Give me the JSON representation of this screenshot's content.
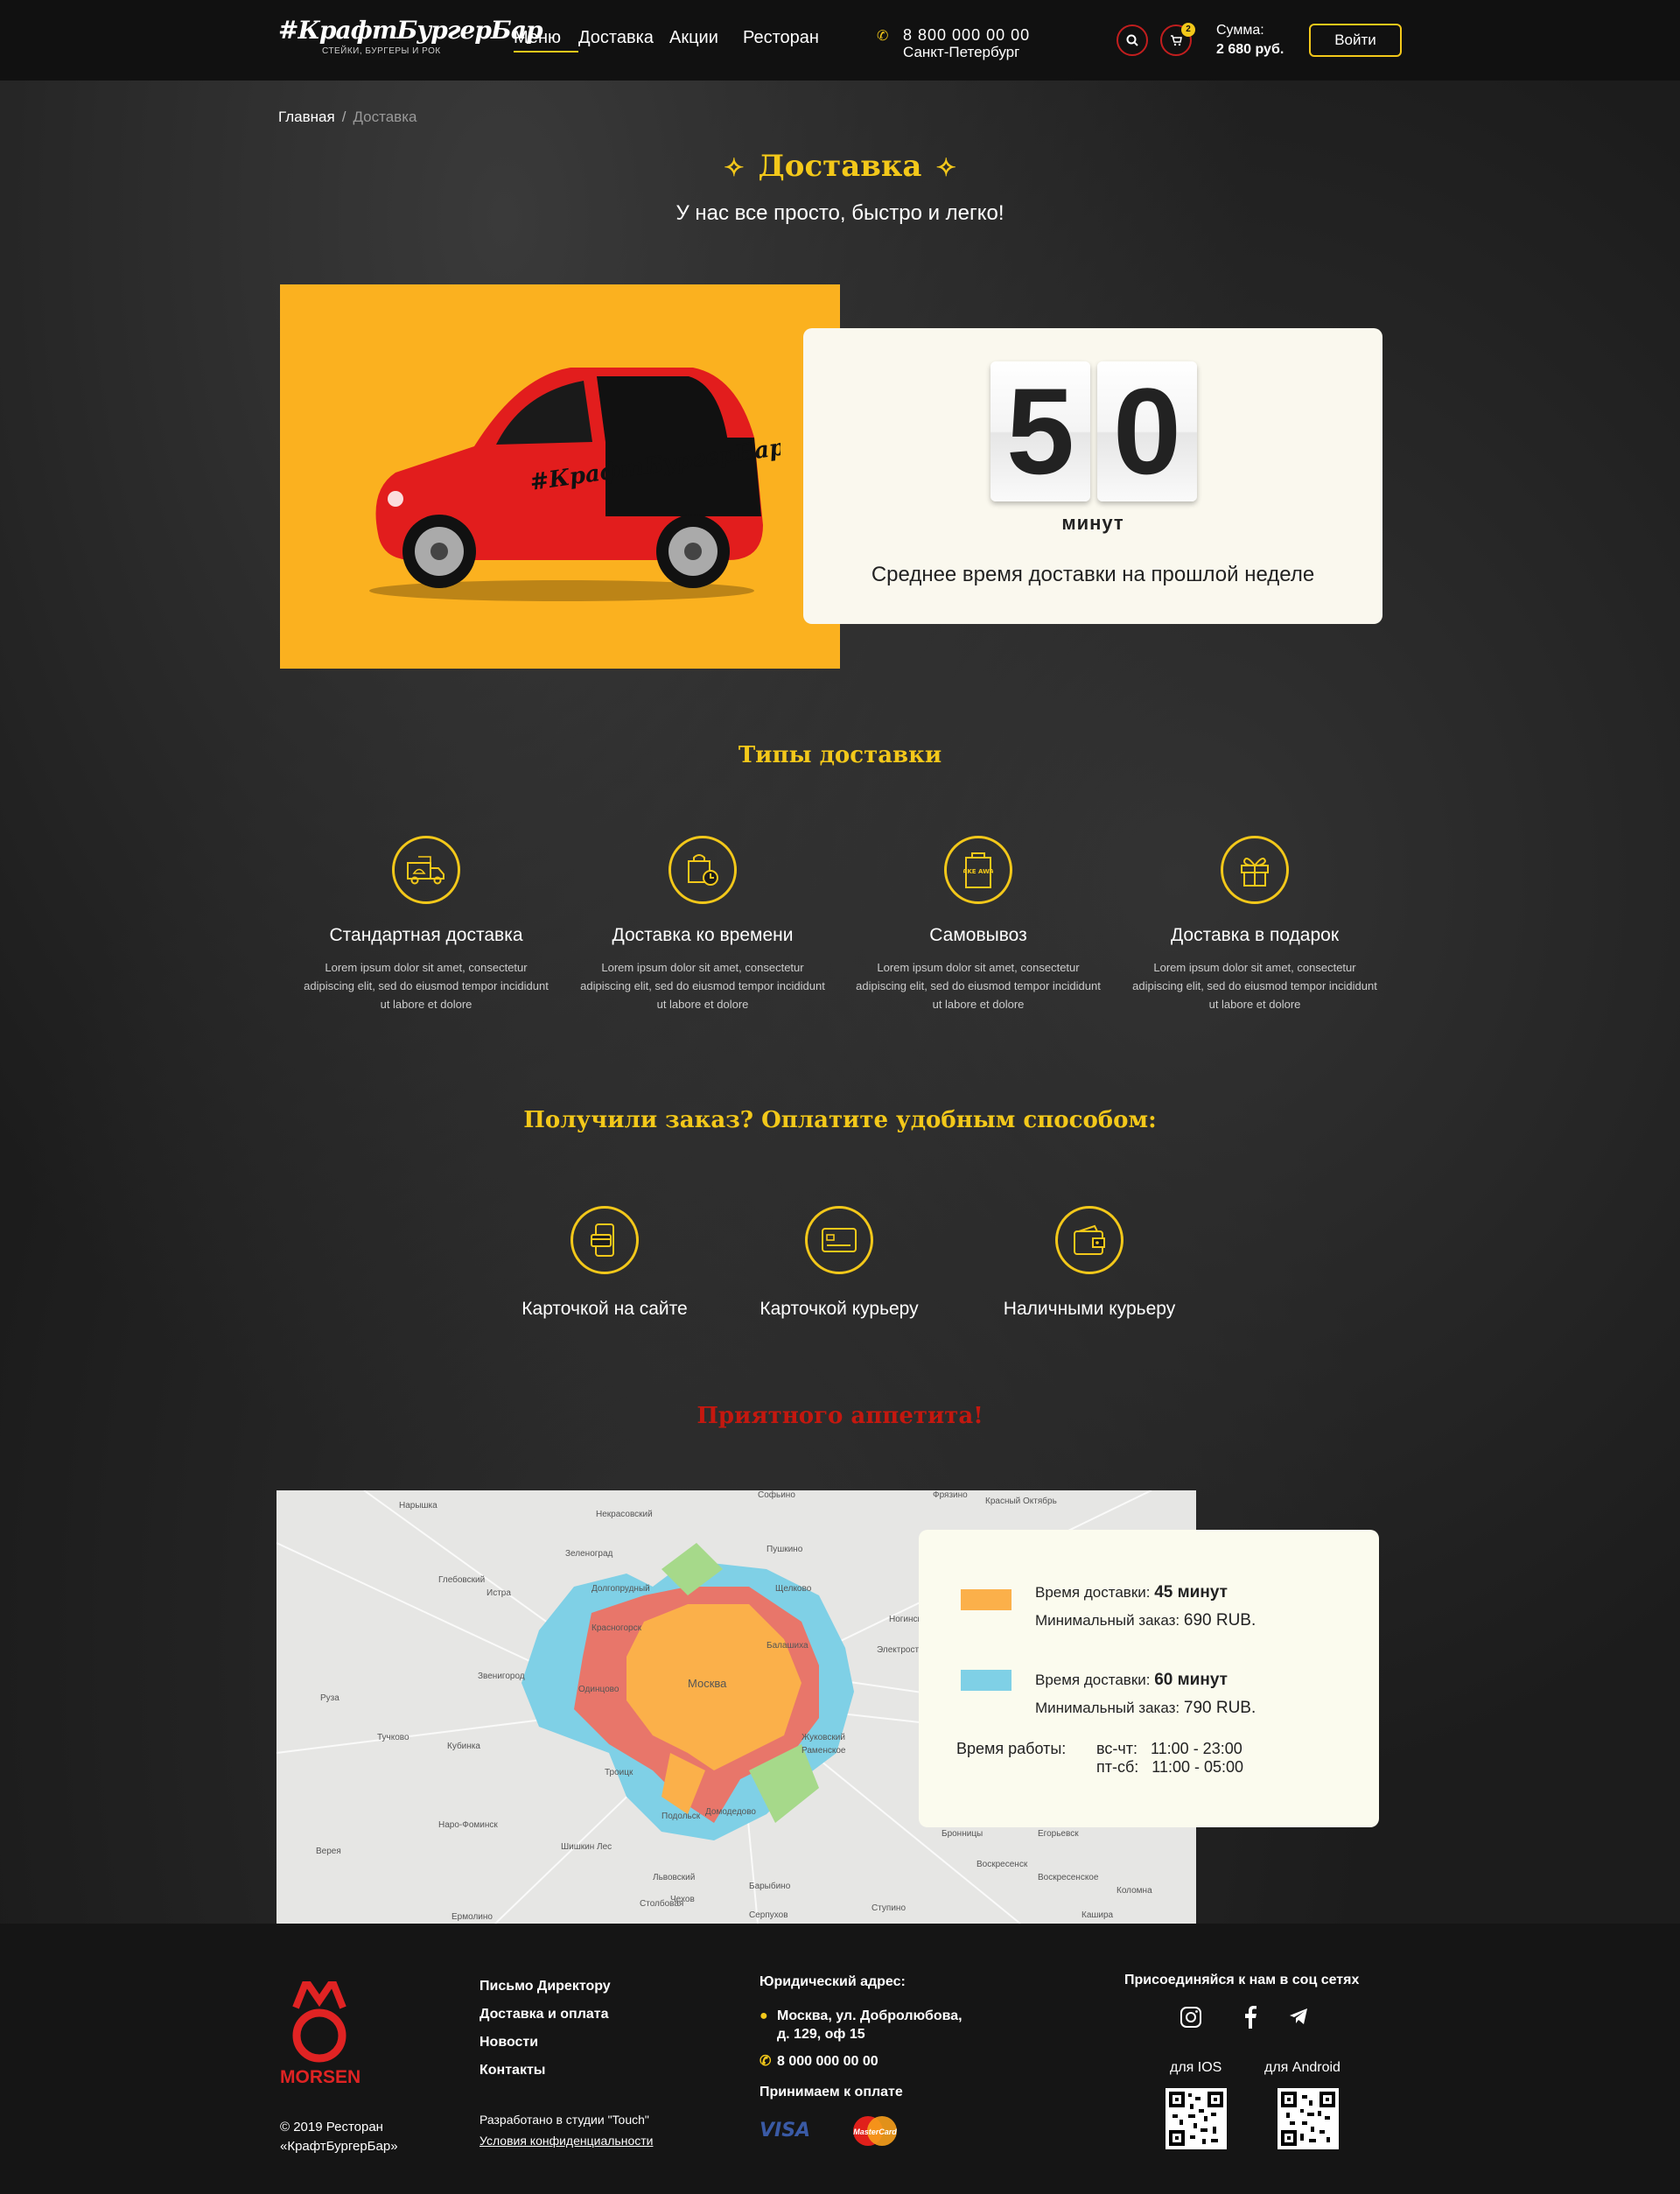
{
  "header": {
    "logo_text": "#КрафтБургерБар",
    "logo_sub": "СТЕЙКИ, БУРГЕРЫ И РОК",
    "nav": [
      "Меню",
      "Доставка",
      "Акции",
      "Ресторан"
    ],
    "phone": "8 800 000 00 00",
    "city": "Санкт-Петербург",
    "cart_count": "2",
    "sum_label": "Сумма:",
    "sum_value": "2 680 руб.",
    "login_label": "Войти"
  },
  "breadcrumb": {
    "home": "Главная",
    "sep": "/",
    "current": "Доставка"
  },
  "page": {
    "title": "Доставка",
    "subtitle": "У нас все просто, быстро и легко!"
  },
  "hero": {
    "car_brand": "#КрафтБургерБар",
    "digit1": "5",
    "digit2": "0",
    "unit": "минут",
    "description": "Среднее время доставки на прошлой неделе"
  },
  "delivery_types": {
    "title": "Типы доставки",
    "items": [
      {
        "title": "Стандартная доставка",
        "icon": "truck-icon",
        "desc": "Lorem ipsum dolor sit amet, consectetur adipiscing elit, sed do eiusmod tempor incididunt ut labore et dolore"
      },
      {
        "title": "Доставка ко времени",
        "icon": "clock-bag-icon",
        "desc": "Lorem ipsum dolor sit amet, consectetur adipiscing elit, sed do eiusmod tempor incididunt ut labore et dolore"
      },
      {
        "title": "Самовывоз",
        "icon": "take-away-icon",
        "desc": "Lorem ipsum dolor sit amet, consectetur adipiscing elit, sed do eiusmod tempor incididunt ut labore et dolore"
      },
      {
        "title": "Доставка в подарок",
        "icon": "gift-icon",
        "desc": "Lorem ipsum dolor sit amet, consectetur adipiscing elit, sed do eiusmod tempor incididunt ut labore et dolore"
      }
    ],
    "take_away_icon_text": "TAKE AWAY"
  },
  "payment": {
    "title": "Получили заказ? Оплатите удобным способом:",
    "items": [
      {
        "title": "Карточкой на сайте",
        "icon": "phone-card-icon"
      },
      {
        "title": "Карточкой курьеру",
        "icon": "credit-card-icon"
      },
      {
        "title": "Наличными курьеру",
        "icon": "wallet-icon"
      }
    ]
  },
  "appetite": "Приятного аппетита!",
  "map": {
    "center_label": "Москва",
    "labels": [
      "Нарышка",
      "Некрасовский",
      "Софьино",
      "Фрязино",
      "Красный Октябрь",
      "Зеленоград",
      "Пушкино",
      "Истра",
      "Долгопрудный",
      "Щелково",
      "Красногорск",
      "Балашиха",
      "Ногинск",
      "Одинцово",
      "Электросталь",
      "Звенигород",
      "Руза",
      "Раменское",
      "Жуковский",
      "Тучково",
      "Кубинка",
      "Троицк",
      "Домодедово",
      "Подольск",
      "Наро-Фоминск",
      "Верея",
      "Чехов",
      "Егорьевск",
      "Воскресенск",
      "Коломна",
      "Ступино",
      "Серпухов",
      "Кашира",
      "Ермолино",
      "Барыбино",
      "Бронницы",
      "Глебовский",
      "Воскресенское",
      "Шишкин Лес",
      "Львовский",
      "Столбовая"
    ],
    "color_45": "#fbb04a",
    "color_60": "#7fd0e6",
    "color_extra": "#e8766a"
  },
  "map_card": {
    "zone1_time_label": "Время доставки:",
    "zone1_time": "45 минут",
    "zone1_min_label": "Минимальный заказ:",
    "zone1_min": "690 RUB.",
    "zone2_time_label": "Время доставки:",
    "zone2_time": "60 минут",
    "zone2_min_label": "Минимальный заказ:",
    "zone2_min": "790 RUB.",
    "hours_label": "Время работы:",
    "hours1": "вс-чт:   11:00 - 23:00",
    "hours2": "пт-сб:   11:00 - 05:00"
  },
  "footer": {
    "brand": "MORSEN",
    "copyright1": "© 2019 Ресторан",
    "copyright2": "«КрафтБургерБар»",
    "links": [
      "Письмо Директору",
      "Доставка и оплата",
      "Новости",
      "Контакты"
    ],
    "studio": "Разработано в студии \"Touch\"",
    "privacy": "Условия конфиденциальности",
    "address_label": "Юридический адрес:",
    "address1": "Москва, ул. Добролюбова,",
    "address2": "д. 129, оф 15",
    "phone": "8 000 000 00 00",
    "pay_label": "Принимаем к оплате",
    "visa": "VISA",
    "mastercard": "MasterCard",
    "social_label": "Присоединяйся к нам в соц сетях",
    "ios": "для IOS",
    "android": "для Android"
  },
  "colors": {
    "accent": "#f3c81a",
    "red": "#c4180f",
    "hero_bg": "#fbb11f",
    "card_bg": "#faf8ee"
  }
}
